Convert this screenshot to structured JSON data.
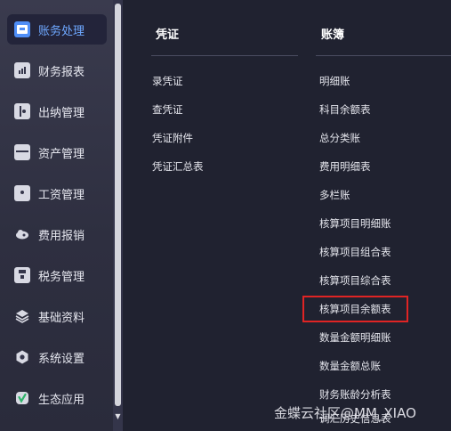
{
  "sidebar": {
    "items": [
      {
        "label": "账务处理",
        "icon": "ledger-icon",
        "active": true
      },
      {
        "label": "财务报表",
        "icon": "report-icon"
      },
      {
        "label": "出纳管理",
        "icon": "cashier-icon"
      },
      {
        "label": "资产管理",
        "icon": "asset-icon"
      },
      {
        "label": "工资管理",
        "icon": "payroll-icon"
      },
      {
        "label": "费用报销",
        "icon": "expense-icon"
      },
      {
        "label": "税务管理",
        "icon": "tax-icon"
      },
      {
        "label": "基础资料",
        "icon": "layers-icon"
      },
      {
        "label": "系统设置",
        "icon": "settings-icon"
      },
      {
        "label": "生态应用",
        "icon": "apps-icon"
      }
    ]
  },
  "menu": {
    "voucher": {
      "title": "凭证",
      "links": [
        "录凭证",
        "查凭证",
        "凭证附件",
        "凭证汇总表"
      ]
    },
    "ledger": {
      "title": "账簿",
      "links": [
        "明细账",
        "科目余额表",
        "总分类账",
        "费用明细表",
        "多栏账",
        "核算项目明细账",
        "核算项目组合表",
        "核算项目综合表",
        "核算项目余额表",
        "数量金额明细账",
        "数量金额总账",
        "财务账龄分析表",
        "调汇历史信息表"
      ],
      "highlighted": "核算项目余额表"
    }
  },
  "watermark": "金蝶云社区@MM_XIAO",
  "colors": {
    "accent": "#4f8ef7",
    "highlight": "#e02424",
    "panel_bg": "#202230"
  }
}
